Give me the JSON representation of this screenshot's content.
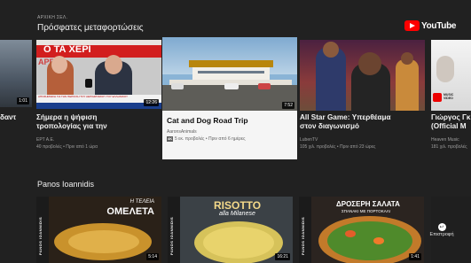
{
  "header": {
    "breadcrumb": "ΑΡΧΙΚΗ ΣΕΛ.",
    "section_title": "Πρόσφατες μεταφορτώσεις",
    "logo_text": "YouTube"
  },
  "row1": [
    {
      "title": "δαντ",
      "duration": "1:01"
    },
    {
      "title_line1": "Σήμερα η ψήφιση",
      "title_line2": "τροπολογίας για την",
      "channel": "ΕΡΤ Α.Ε.",
      "meta": "40 προβολές • Πριν από 1 ώρα",
      "duration": "12:26",
      "thumb_text1": "Ο ΤΑ ΧΕΡΙ",
      "thumb_text2": "ΑΡΓΚ",
      "thumb_strip": "ΑΠΟΖΗΜΙΩΣΗ ΓΙΑ ΤΗΝ ΠΕΡΙΟΧΗ ΤΟΥ ΑΕΡΟΔΡΟΜΙΟΥ ΤΟΥ ΕΛΛΗΝΙΚΟΥ"
    },
    {
      "title": "Cat and Dog Road Trip",
      "channel": "AaronsAnimals",
      "badge": "4K",
      "meta": "5 εκ. προβολές • Πριν από 6 ημέρες",
      "duration": "7:52"
    },
    {
      "title_line1": "All Star Game: Υπερθέαμα",
      "title_line2": "στον διαγωνισμό",
      "channel": "LubenTV",
      "meta": "105 χιλ. προβολές • Πριν από 23 ώρες",
      "duration": ""
    },
    {
      "title_line1": "Γιώργος Γκ",
      "title_line2": "(Official M",
      "channel": "Heaven Music",
      "meta": "181 χιλ. προβολές",
      "badge": "MUSIC VIDEO"
    }
  ],
  "row2_label": "Panos Ioannidis",
  "row2": [
    {
      "tag": "PANOS IOANNIDIS",
      "text1": "Η ΤΕΛΕΙΑ",
      "text2": "ΟΜΕΛΕΤΑ",
      "duration": "5:14"
    },
    {
      "tag": "PANOS IOANNIDIS",
      "text1": "RISOTTO",
      "text2": "alla Milanese",
      "duration": "16:21"
    },
    {
      "tag": "PANOS IOANNIDIS",
      "text1": "ΔΡΟΣΕΡΗ ΣΑΛΑΤΑ",
      "text2": "ΣΠΑΝΑΚΙ ΜΕ ΠΟΡΤΟΚΑΛΙ",
      "duration": "1:41"
    }
  ],
  "return_label": "Επιστροφή"
}
